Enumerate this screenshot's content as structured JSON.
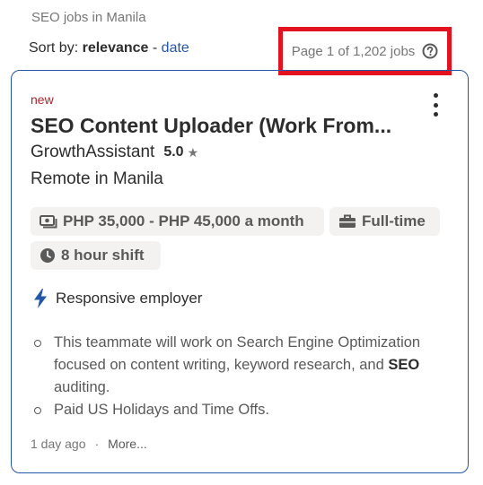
{
  "header": {
    "breadcrumb": "SEO jobs in Manila",
    "sort_prefix": "Sort by:",
    "sort_active": "relevance",
    "sort_separator": "-",
    "sort_alt": "date",
    "page_count": "Page 1 of 1,202 jobs"
  },
  "job": {
    "badge": "new",
    "title": "SEO Content Uploader (Work From...",
    "company": "GrowthAssistant",
    "rating": "5.0",
    "location": "Remote in Manila",
    "salary": "PHP 35,000 - PHP 45,000 a month",
    "job_type": "Full-time",
    "shift": "8 hour shift",
    "responsive_label": "Responsive employer",
    "snippet": [
      {
        "pre": "This teammate will work on Search Engine Optimization focused on content writing, keyword research, and ",
        "bold": "SEO",
        "post": " auditing."
      },
      {
        "pre": "Paid US Holidays and Time Offs.",
        "bold": "",
        "post": ""
      }
    ],
    "posted": "1 day ago",
    "dot": "·",
    "more": "More..."
  },
  "colors": {
    "accent": "#2557a7",
    "new_badge": "#a9252b",
    "highlight_box": "#e2131f",
    "chip_bg": "#f3f2f1"
  },
  "icons": [
    "help-icon",
    "more-vertical-icon",
    "star-icon",
    "money-icon",
    "briefcase-icon",
    "clock-icon",
    "lightning-icon"
  ]
}
